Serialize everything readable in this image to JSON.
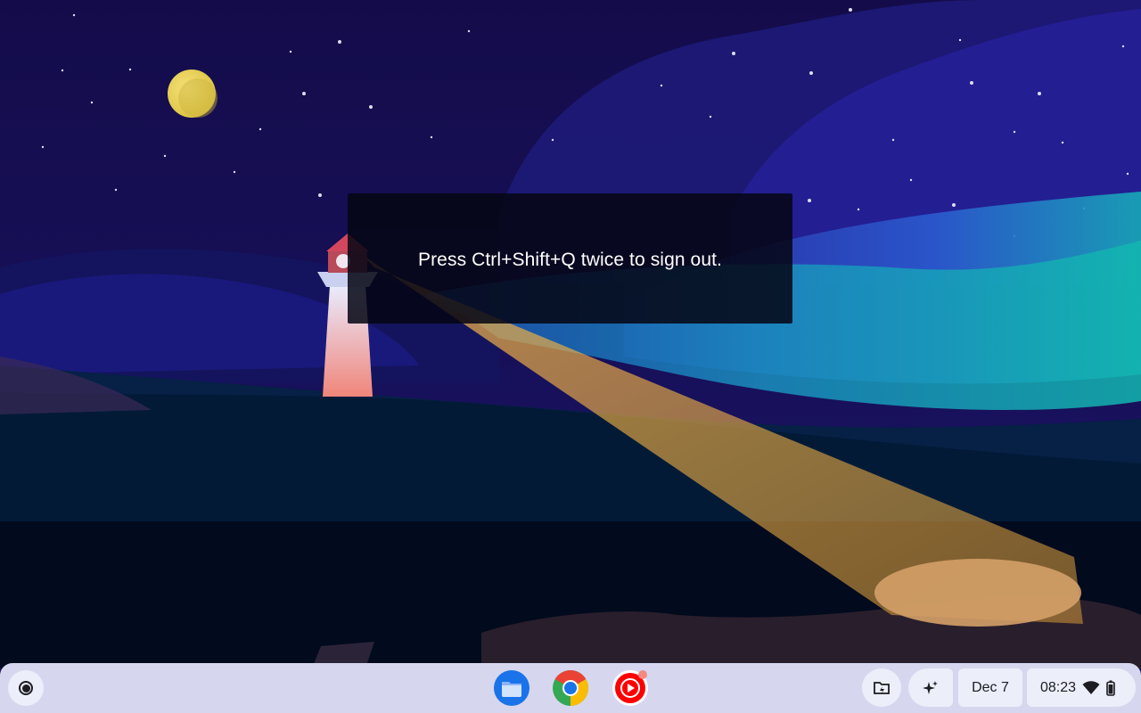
{
  "toast": {
    "message": "Press Ctrl+Shift+Q twice to sign out."
  },
  "shelf": {
    "launcher": {
      "icon": "launcher-icon"
    },
    "apps": [
      {
        "name": "Files",
        "icon": "files-icon"
      },
      {
        "name": "Google Chrome",
        "icon": "chrome-icon"
      },
      {
        "name": "YouTube Music",
        "icon": "youtube-music-icon"
      }
    ],
    "tray": {
      "holding_space_icon": "holding-space-icon",
      "sparkle_icon": "sparkle-icon",
      "date": "Dec 7",
      "time": "08:23",
      "wifi_icon": "wifi-icon",
      "battery_icon": "battery-icon"
    }
  },
  "colors": {
    "shelf_bg": "#d6d7ef",
    "tray_bg": "#eceefa",
    "toast_bg": "#05061a"
  }
}
